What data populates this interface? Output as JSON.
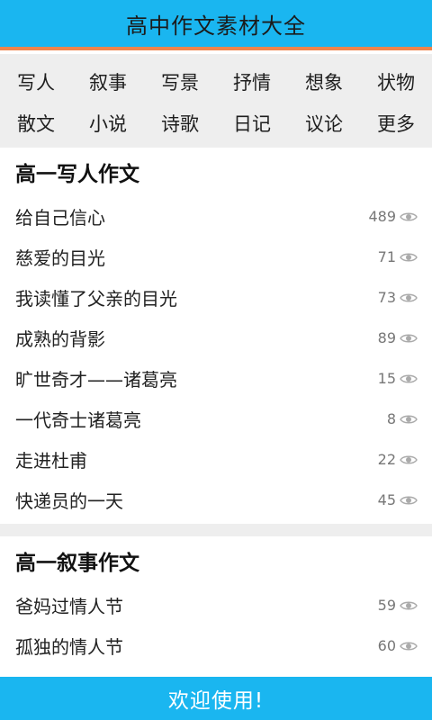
{
  "header": {
    "title": "高中作文素材大全"
  },
  "categories": [
    {
      "label": "写人"
    },
    {
      "label": "叙事"
    },
    {
      "label": "写景"
    },
    {
      "label": "抒情"
    },
    {
      "label": "想象"
    },
    {
      "label": "状物"
    },
    {
      "label": "散文"
    },
    {
      "label": "小说"
    },
    {
      "label": "诗歌"
    },
    {
      "label": "日记"
    },
    {
      "label": "议论"
    },
    {
      "label": "更多"
    }
  ],
  "sections": [
    {
      "title": "高一写人作文",
      "items": [
        {
          "title": "给自己信心",
          "views": "489"
        },
        {
          "title": "慈爱的目光",
          "views": "71"
        },
        {
          "title": "我读懂了父亲的目光",
          "views": "73"
        },
        {
          "title": "成熟的背影",
          "views": "89"
        },
        {
          "title": "旷世奇才——诸葛亮",
          "views": "15"
        },
        {
          "title": "一代奇士诸葛亮",
          "views": "8"
        },
        {
          "title": "走进杜甫",
          "views": "22"
        },
        {
          "title": "快递员的一天",
          "views": "45"
        }
      ]
    },
    {
      "title": "高一叙事作文",
      "items": [
        {
          "title": "爸妈过情人节",
          "views": "59"
        },
        {
          "title": "孤独的情人节",
          "views": "60"
        }
      ]
    }
  ],
  "footer": {
    "text": "欢迎使用!"
  },
  "icons": {
    "view_count": "eye-icon"
  },
  "colors": {
    "brand_blue": "#1ab6f0",
    "accent_orange": "#f0844a",
    "grid_bg": "#eeeeee"
  }
}
